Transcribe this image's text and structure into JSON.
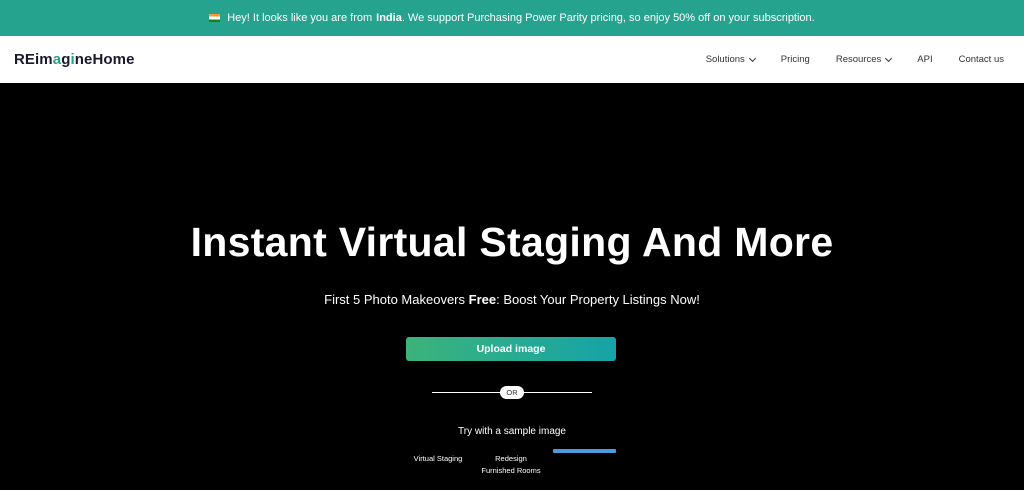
{
  "promo": {
    "prefix": "Hey! It looks like you are from",
    "country": "India",
    "suffix": ". We support Purchasing Power Parity pricing, so enjoy 50% off on your subscription.",
    "background": "#26a38f"
  },
  "nav": {
    "logo_pre": "REim",
    "logo_accent": "a",
    "logo_mid": "g",
    "logo_accent2": "i",
    "logo_post": "neHome",
    "items": [
      {
        "label": "Solutions",
        "dropdown": true
      },
      {
        "label": "Pricing",
        "dropdown": false
      },
      {
        "label": "Resources",
        "dropdown": true
      },
      {
        "label": "API",
        "dropdown": false
      },
      {
        "label": "Contact us",
        "dropdown": false
      }
    ]
  },
  "hero": {
    "title": "Instant Virtual Staging And More",
    "sub_pre": "First 5 Photo Makeovers ",
    "sub_bold": "Free",
    "sub_post": ": Boost Your Property Listings Now!",
    "upload_label": "Upload image",
    "or_label": "OR",
    "sample_title": "Try with a sample image",
    "sample_options": [
      "Virtual Staging",
      "Redesign\nFurnished Rooms"
    ]
  }
}
